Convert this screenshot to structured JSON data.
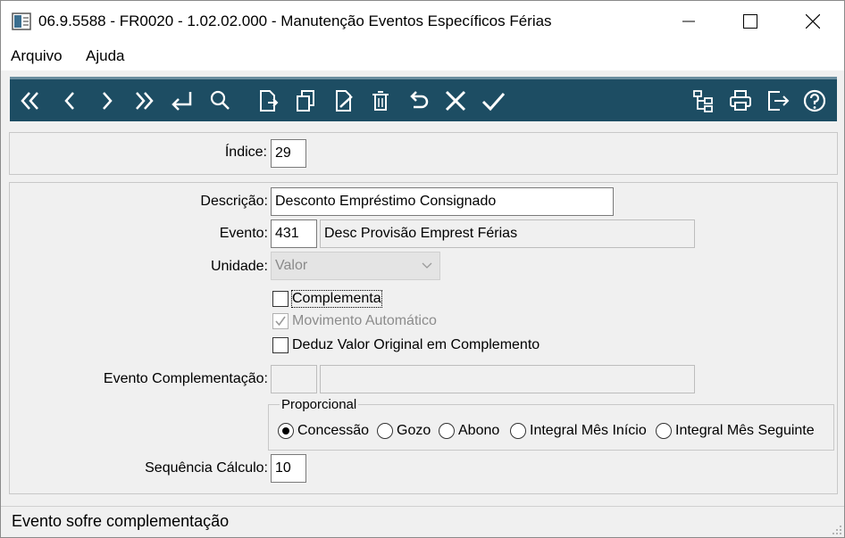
{
  "window": {
    "title": "06.9.5588 - FR0020 - 1.02.02.000 - Manutenção Eventos Específicos Férias"
  },
  "menu": {
    "file_label": "Arquivo",
    "help_label": "Ajuda"
  },
  "toolbar": {
    "left_icons": [
      "first-icon",
      "previous-icon",
      "next-icon",
      "last-icon",
      "goto-icon",
      "search-icon",
      "new-icon",
      "copy-icon",
      "edit-icon",
      "delete-icon",
      "undo-icon",
      "cancel-icon",
      "confirm-icon"
    ],
    "right_icons": [
      "tree-icon",
      "print-icon",
      "exit-icon",
      "help-icon"
    ]
  },
  "index": {
    "label": "Índice:",
    "value": "29"
  },
  "form": {
    "description_label": "Descrição:",
    "description_value": "Desconto Empréstimo Consignado",
    "event_label": "Evento:",
    "event_code": "431",
    "event_desc": "Desc Provisão Emprest Férias",
    "unit_label": "Unidade:",
    "unit_value": "Valor",
    "complementa_label": "Complementa",
    "complementa_checked": false,
    "movimento_label": "Movimento Automático",
    "movimento_checked": true,
    "deduz_label": "Deduz Valor Original em Complemento",
    "deduz_checked": false,
    "event_comp_label": "Evento Complementação:",
    "event_comp_code": "",
    "event_comp_desc": "",
    "proporcional": {
      "title": "Proporcional",
      "options": [
        "Concessão",
        "Gozo",
        "Abono",
        "Integral Mês Início",
        "Integral Mês Seguinte"
      ],
      "selected": "Concessão"
    },
    "sequence_label": "Sequência Cálculo:",
    "sequence_value": "10"
  },
  "status": {
    "text": "Evento sofre complementação"
  }
}
